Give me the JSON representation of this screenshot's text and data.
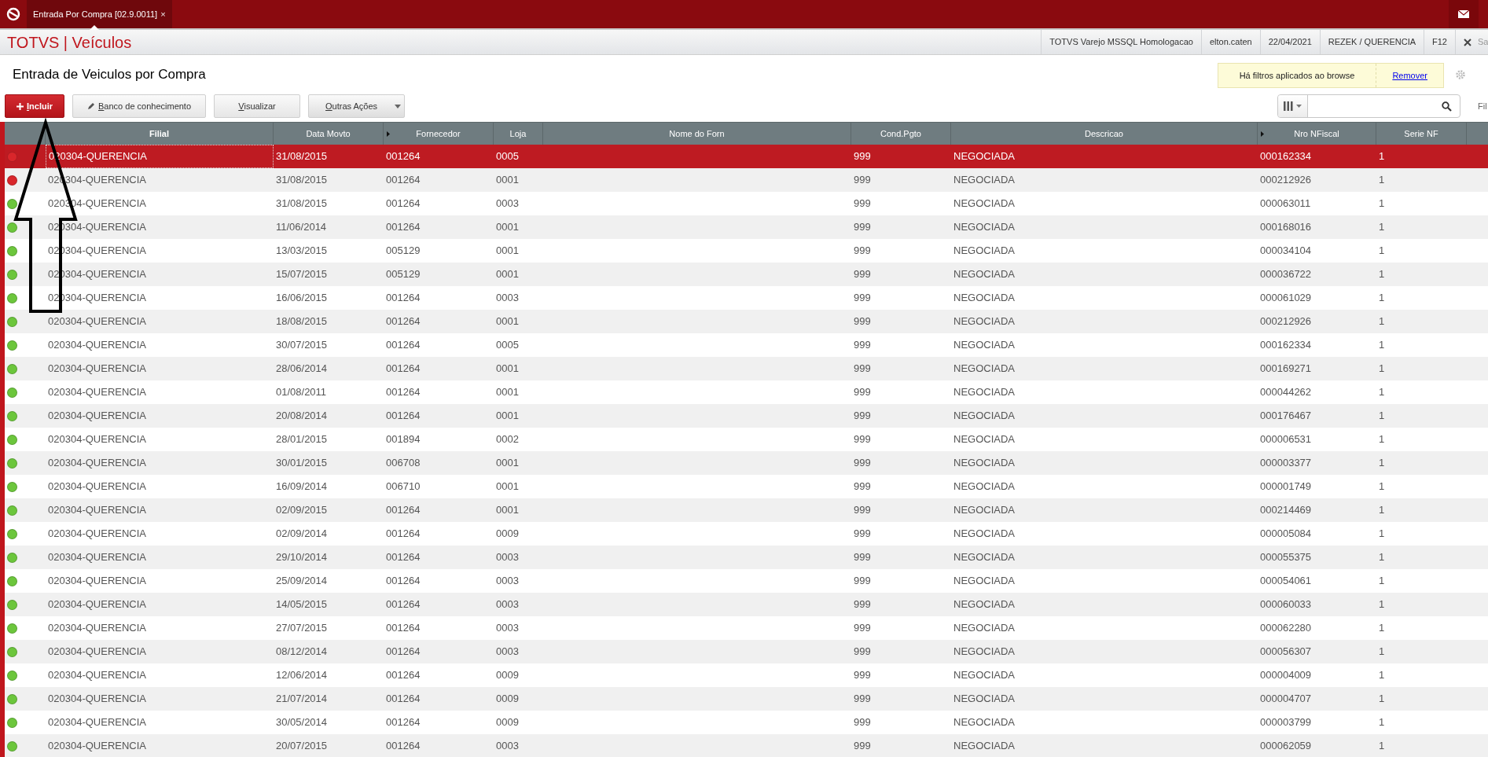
{
  "top_bar": {
    "tab": {
      "label": "Entrada Por Compra [02.9.0011]",
      "close": "×",
      "selected": true
    }
  },
  "header": {
    "brand": "TOTVS | Veículos",
    "info": [
      "TOTVS Varejo MSSQL Homologacao",
      "elton.caten",
      "22/04/2021",
      "REZEK / QUERENCIA",
      "F12"
    ],
    "close_label": "Sa"
  },
  "page_title": "Entrada de Veiculos por Compra",
  "filter_notice": {
    "text": "Há filtros aplicados ao browse",
    "link": "Remover"
  },
  "buttons": [
    {
      "label": "Incluir",
      "kind": "primary"
    },
    {
      "label": "Banco de conhecimento",
      "kind": "pencil"
    },
    {
      "label": "Visualizar",
      "kind": "plain"
    },
    {
      "label": "Outras Ações",
      "kind": "menu"
    }
  ],
  "search": {
    "side_label": "Fil"
  },
  "table": {
    "columns": [
      {
        "label": "Filial",
        "marker": false
      },
      {
        "label": "Data Movto",
        "marker": false
      },
      {
        "label": "Fornecedor",
        "marker": true
      },
      {
        "label": "Loja",
        "marker": false
      },
      {
        "label": "Nome do Forn",
        "marker": false
      },
      {
        "label": "Cond.Pgto",
        "marker": false
      },
      {
        "label": "Descricao",
        "marker": false
      },
      {
        "label": "Nro NFiscal",
        "marker": true
      },
      {
        "label": "Serie NF",
        "marker": false
      }
    ],
    "rows": [
      {
        "color": "#d9262b",
        "selected": true,
        "filial": "020304-QUERENCIA",
        "data_movto": "31/08/2015",
        "fornecedor": "001264",
        "loja": "0005",
        "cond_pgto": "999",
        "descricao": "NEGOCIADA",
        "nro_nfiscal": "000162334",
        "serie_nf": "1"
      },
      {
        "color": "#d9262b",
        "selected": false,
        "filial": "020304-QUERENCIA",
        "data_movto": "31/08/2015",
        "fornecedor": "001264",
        "loja": "0001",
        "cond_pgto": "999",
        "descricao": "NEGOCIADA",
        "nro_nfiscal": "000212926",
        "serie_nf": "1"
      },
      {
        "color": "#6cc63c",
        "selected": false,
        "filial": "020304-QUERENCIA",
        "data_movto": "31/08/2015",
        "fornecedor": "001264",
        "loja": "0003",
        "cond_pgto": "999",
        "descricao": "NEGOCIADA",
        "nro_nfiscal": "000063011",
        "serie_nf": "1"
      },
      {
        "color": "#6cc63c",
        "selected": false,
        "filial": "020304-QUERENCIA",
        "data_movto": "11/06/2014",
        "fornecedor": "001264",
        "loja": "0001",
        "cond_pgto": "999",
        "descricao": "NEGOCIADA",
        "nro_nfiscal": "000168016",
        "serie_nf": "1"
      },
      {
        "color": "#6cc63c",
        "selected": false,
        "filial": "020304-QUERENCIA",
        "data_movto": "13/03/2015",
        "fornecedor": "005129",
        "loja": "0001",
        "cond_pgto": "999",
        "descricao": "NEGOCIADA",
        "nro_nfiscal": "000034104",
        "serie_nf": "1"
      },
      {
        "color": "#6cc63c",
        "selected": false,
        "filial": "020304-QUERENCIA",
        "data_movto": "15/07/2015",
        "fornecedor": "005129",
        "loja": "0001",
        "cond_pgto": "999",
        "descricao": "NEGOCIADA",
        "nro_nfiscal": "000036722",
        "serie_nf": "1"
      },
      {
        "color": "#6cc63c",
        "selected": false,
        "filial": "020304-QUERENCIA",
        "data_movto": "16/06/2015",
        "fornecedor": "001264",
        "loja": "0003",
        "cond_pgto": "999",
        "descricao": "NEGOCIADA",
        "nro_nfiscal": "000061029",
        "serie_nf": "1"
      },
      {
        "color": "#6cc63c",
        "selected": false,
        "filial": "020304-QUERENCIA",
        "data_movto": "18/08/2015",
        "fornecedor": "001264",
        "loja": "0001",
        "cond_pgto": "999",
        "descricao": "NEGOCIADA",
        "nro_nfiscal": "000212926",
        "serie_nf": "1"
      },
      {
        "color": "#6cc63c",
        "selected": false,
        "filial": "020304-QUERENCIA",
        "data_movto": "30/07/2015",
        "fornecedor": "001264",
        "loja": "0005",
        "cond_pgto": "999",
        "descricao": "NEGOCIADA",
        "nro_nfiscal": "000162334",
        "serie_nf": "1"
      },
      {
        "color": "#6cc63c",
        "selected": false,
        "filial": "020304-QUERENCIA",
        "data_movto": "28/06/2014",
        "fornecedor": "001264",
        "loja": "0001",
        "cond_pgto": "999",
        "descricao": "NEGOCIADA",
        "nro_nfiscal": "000169271",
        "serie_nf": "1"
      },
      {
        "color": "#6cc63c",
        "selected": false,
        "filial": "020304-QUERENCIA",
        "data_movto": "01/08/2011",
        "fornecedor": "001264",
        "loja": "0001",
        "cond_pgto": "999",
        "descricao": "NEGOCIADA",
        "nro_nfiscal": "000044262",
        "serie_nf": "1"
      },
      {
        "color": "#6cc63c",
        "selected": false,
        "filial": "020304-QUERENCIA",
        "data_movto": "20/08/2014",
        "fornecedor": "001264",
        "loja": "0001",
        "cond_pgto": "999",
        "descricao": "NEGOCIADA",
        "nro_nfiscal": "000176467",
        "serie_nf": "1"
      },
      {
        "color": "#6cc63c",
        "selected": false,
        "filial": "020304-QUERENCIA",
        "data_movto": "28/01/2015",
        "fornecedor": "001894",
        "loja": "0002",
        "cond_pgto": "999",
        "descricao": "NEGOCIADA",
        "nro_nfiscal": "000006531",
        "serie_nf": "1"
      },
      {
        "color": "#6cc63c",
        "selected": false,
        "filial": "020304-QUERENCIA",
        "data_movto": "30/01/2015",
        "fornecedor": "006708",
        "loja": "0001",
        "cond_pgto": "999",
        "descricao": "NEGOCIADA",
        "nro_nfiscal": "000003377",
        "serie_nf": "1"
      },
      {
        "color": "#6cc63c",
        "selected": false,
        "filial": "020304-QUERENCIA",
        "data_movto": "16/09/2014",
        "fornecedor": "006710",
        "loja": "0001",
        "cond_pgto": "999",
        "descricao": "NEGOCIADA",
        "nro_nfiscal": "000001749",
        "serie_nf": "1"
      },
      {
        "color": "#6cc63c",
        "selected": false,
        "filial": "020304-QUERENCIA",
        "data_movto": "02/09/2015",
        "fornecedor": "001264",
        "loja": "0001",
        "cond_pgto": "999",
        "descricao": "NEGOCIADA",
        "nro_nfiscal": "000214469",
        "serie_nf": "1"
      },
      {
        "color": "#6cc63c",
        "selected": false,
        "filial": "020304-QUERENCIA",
        "data_movto": "02/09/2014",
        "fornecedor": "001264",
        "loja": "0009",
        "cond_pgto": "999",
        "descricao": "NEGOCIADA",
        "nro_nfiscal": "000005084",
        "serie_nf": "1"
      },
      {
        "color": "#6cc63c",
        "selected": false,
        "filial": "020304-QUERENCIA",
        "data_movto": "29/10/2014",
        "fornecedor": "001264",
        "loja": "0003",
        "cond_pgto": "999",
        "descricao": "NEGOCIADA",
        "nro_nfiscal": "000055375",
        "serie_nf": "1"
      },
      {
        "color": "#6cc63c",
        "selected": false,
        "filial": "020304-QUERENCIA",
        "data_movto": "25/09/2014",
        "fornecedor": "001264",
        "loja": "0003",
        "cond_pgto": "999",
        "descricao": "NEGOCIADA",
        "nro_nfiscal": "000054061",
        "serie_nf": "1"
      },
      {
        "color": "#6cc63c",
        "selected": false,
        "filial": "020304-QUERENCIA",
        "data_movto": "14/05/2015",
        "fornecedor": "001264",
        "loja": "0003",
        "cond_pgto": "999",
        "descricao": "NEGOCIADA",
        "nro_nfiscal": "000060033",
        "serie_nf": "1"
      },
      {
        "color": "#6cc63c",
        "selected": false,
        "filial": "020304-QUERENCIA",
        "data_movto": "27/07/2015",
        "fornecedor": "001264",
        "loja": "0003",
        "cond_pgto": "999",
        "descricao": "NEGOCIADA",
        "nro_nfiscal": "000062280",
        "serie_nf": "1"
      },
      {
        "color": "#6cc63c",
        "selected": false,
        "filial": "020304-QUERENCIA",
        "data_movto": "08/12/2014",
        "fornecedor": "001264",
        "loja": "0003",
        "cond_pgto": "999",
        "descricao": "NEGOCIADA",
        "nro_nfiscal": "000056307",
        "serie_nf": "1"
      },
      {
        "color": "#6cc63c",
        "selected": false,
        "filial": "020304-QUERENCIA",
        "data_movto": "12/06/2014",
        "fornecedor": "001264",
        "loja": "0009",
        "cond_pgto": "999",
        "descricao": "NEGOCIADA",
        "nro_nfiscal": "000004009",
        "serie_nf": "1"
      },
      {
        "color": "#6cc63c",
        "selected": false,
        "filial": "020304-QUERENCIA",
        "data_movto": "21/07/2014",
        "fornecedor": "001264",
        "loja": "0009",
        "cond_pgto": "999",
        "descricao": "NEGOCIADA",
        "nro_nfiscal": "000004707",
        "serie_nf": "1"
      },
      {
        "color": "#6cc63c",
        "selected": false,
        "filial": "020304-QUERENCIA",
        "data_movto": "30/05/2014",
        "fornecedor": "001264",
        "loja": "0009",
        "cond_pgto": "999",
        "descricao": "NEGOCIADA",
        "nro_nfiscal": "000003799",
        "serie_nf": "1"
      },
      {
        "color": "#6cc63c",
        "selected": false,
        "filial": "020304-QUERENCIA",
        "data_movto": "20/07/2015",
        "fornecedor": "001264",
        "loja": "0003",
        "cond_pgto": "999",
        "descricao": "NEGOCIADA",
        "nro_nfiscal": "000062059",
        "serie_nf": "1"
      }
    ]
  }
}
